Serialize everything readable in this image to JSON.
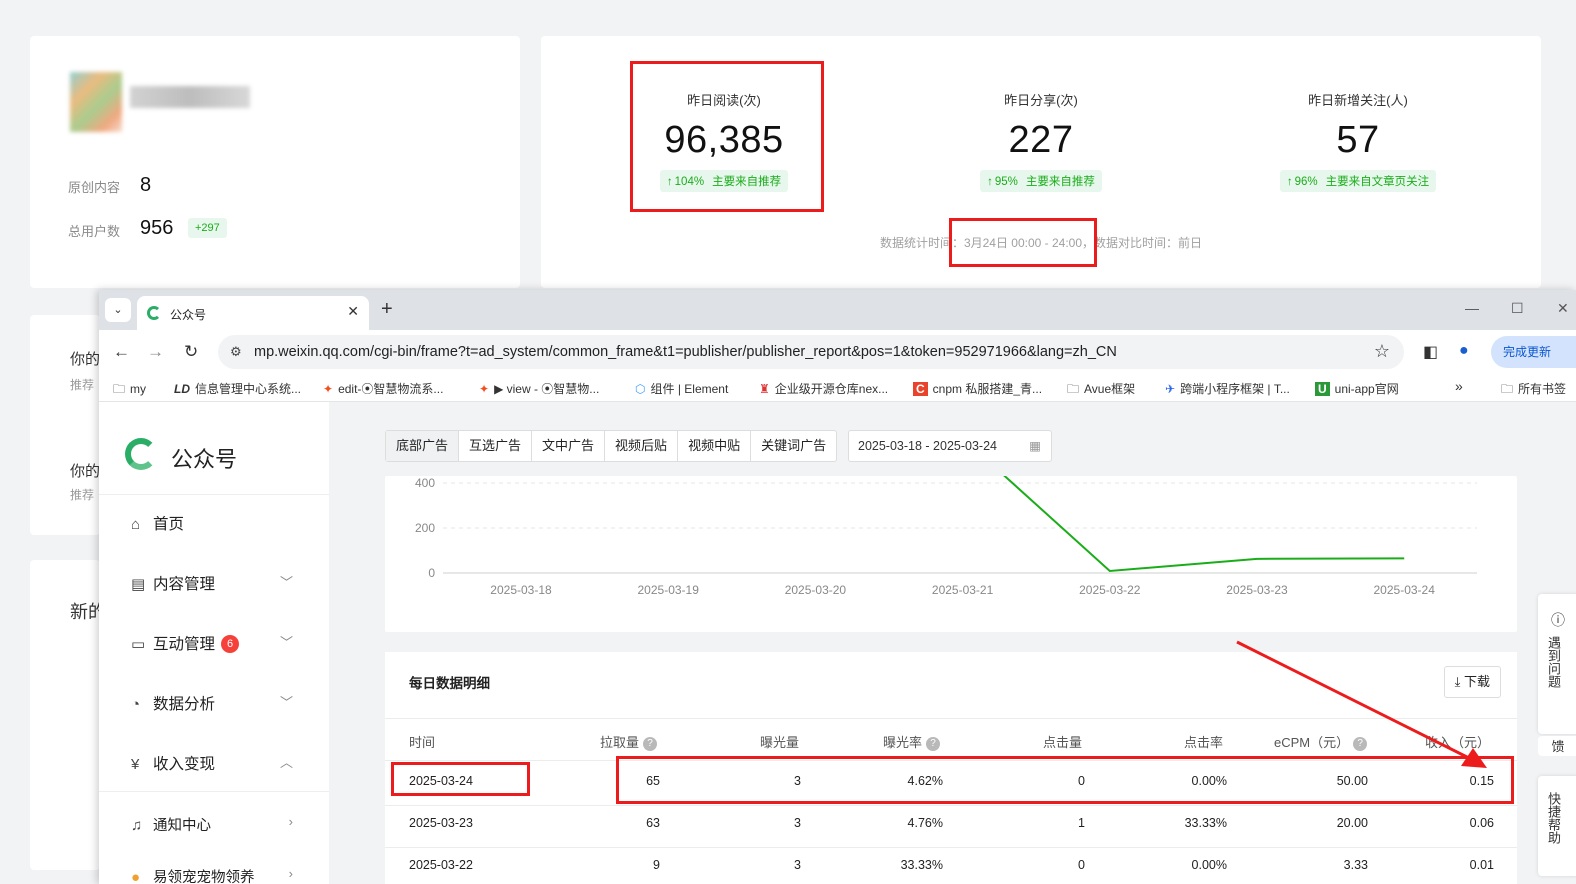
{
  "profile": {
    "original_label": "原创内容",
    "original_value": "8",
    "users_label": "总用户数",
    "users_value": "956",
    "users_delta": "+297"
  },
  "kpis": [
    {
      "label": "昨日阅读(次)",
      "value": "96,385",
      "trend": "↑",
      "pct": "104%",
      "source": "主要来自推荐"
    },
    {
      "label": "昨日分享(次)",
      "value": "227",
      "trend": "↑",
      "pct": "95%",
      "source": "主要来自推荐"
    },
    {
      "label": "昨日新增关注(人)",
      "value": "57",
      "trend": "↑",
      "pct": "96%",
      "source": "主要来自文章页关注"
    }
  ],
  "stats_note": "数据统计时间：3月24日 00:00 - 24:00，数据对比时间：前日",
  "side": {
    "title1": "你的",
    "sub1": "推荐",
    "title2": "你的",
    "sub2": "推荐",
    "title3": "新的"
  },
  "browser": {
    "tab_title": "公众号",
    "tab_close": "✕",
    "new_tab": "+",
    "url": "mp.weixin.qq.com/cgi-bin/frame?t=ad_system/common_frame&t1=publisher/publisher_report&pos=1&token=952971966&lang=zh_CN",
    "update_label": "完成更新",
    "more_bookmarks": "»",
    "bookmarks": [
      {
        "icon": "🗀",
        "label": "my"
      },
      {
        "icon": "LD",
        "label": "信息管理中心系统..."
      },
      {
        "icon": "✦",
        "label": "edit-⦿智慧物流系..."
      },
      {
        "icon": "✦",
        "label": "▶ view - ⦿智慧物..."
      },
      {
        "icon": "⬡",
        "label": "组件 | Element"
      },
      {
        "icon": "♜",
        "label": "企业级开源仓库nex..."
      },
      {
        "icon": "C",
        "label": "cnpm 私服搭建_青..."
      },
      {
        "icon": "🗀",
        "label": "Avue框架"
      },
      {
        "icon": "✈",
        "label": "跨端小程序框架 | T..."
      },
      {
        "icon": "U",
        "label": "uni-app官网"
      },
      {
        "icon": "🗀",
        "label": "所有书签"
      }
    ]
  },
  "app": {
    "name": "公众号",
    "nav": [
      {
        "icon": "⌂",
        "label": "首页",
        "chev": ""
      },
      {
        "icon": "▤",
        "label": "内容管理",
        "chev": "﹀"
      },
      {
        "icon": "▭",
        "label": "互动管理",
        "chev": "﹀",
        "badge": "6"
      },
      {
        "icon": "◔",
        "label": "数据分析",
        "chev": "﹀"
      },
      {
        "icon": "¥",
        "label": "收入变现",
        "chev": "︿"
      },
      {
        "icon": "♫",
        "label": "通知中心",
        "chev": "›"
      },
      {
        "icon": "●",
        "label": "易领宠宠物领养",
        "chev": "›"
      }
    ],
    "ad_tabs": [
      "底部广告",
      "互选广告",
      "文中广告",
      "视频后贴",
      "视频中贴",
      "关键词广告"
    ],
    "date_range": "2025-03-18 - 2025-03-24"
  },
  "chart_data": {
    "type": "line",
    "x": [
      "2025-03-18",
      "2025-03-19",
      "2025-03-20",
      "2025-03-21",
      "2025-03-22",
      "2025-03-23",
      "2025-03-24"
    ],
    "y_ticks": [
      0,
      200,
      400
    ],
    "series": [
      {
        "values": [
          null,
          null,
          null,
          600,
          9,
          63,
          65
        ],
        "color": "#1aad19"
      }
    ],
    "grid": true
  },
  "table": {
    "title": "每日数据明细",
    "download_label": "下载",
    "help_mark": "?",
    "headers": [
      "时间",
      "拉取量",
      "曝光量",
      "曝光率",
      "点击量",
      "点击率",
      "eCPM（元）",
      "收入（元）"
    ],
    "rows": [
      [
        "2025-03-24",
        "65",
        "3",
        "4.62%",
        "0",
        "0.00%",
        "50.00",
        "0.15"
      ],
      [
        "2025-03-23",
        "63",
        "3",
        "4.76%",
        "1",
        "33.33%",
        "20.00",
        "0.06"
      ],
      [
        "2025-03-22",
        "9",
        "3",
        "33.33%",
        "0",
        "0.00%",
        "3.33",
        "0.01"
      ]
    ]
  },
  "help": {
    "top": "遇到问题",
    "mid": "馈",
    "bottom": "快捷帮助"
  }
}
